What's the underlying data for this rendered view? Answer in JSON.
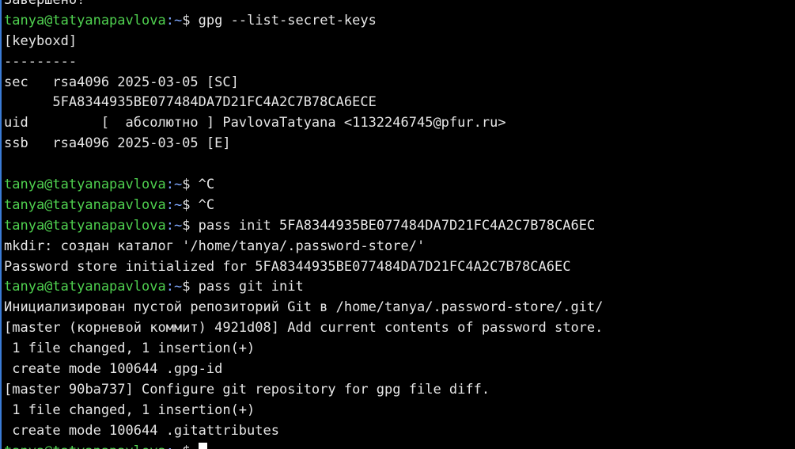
{
  "terminal": {
    "colors": {
      "background": "#000000",
      "text": "#e6e6e6",
      "prompt_user": "#4fd04f",
      "prompt_path": "#7fa8ff"
    },
    "prompt": {
      "user_host": "tanya@tatyanapavlova",
      "path": ":~",
      "symbol": "$ "
    },
    "lines": [
      {
        "type": "output",
        "text": "Завершено!"
      },
      {
        "type": "prompt",
        "cmd": "gpg --list-secret-keys"
      },
      {
        "type": "output",
        "text": "[keyboxd]"
      },
      {
        "type": "output",
        "text": "---------"
      },
      {
        "type": "output",
        "text": "sec   rsa4096 2025-03-05 [SC]"
      },
      {
        "type": "output",
        "text": "      5FA8344935BE077484DA7D21FC4A2C7B78CA6ECE"
      },
      {
        "type": "output",
        "text": "uid         [  абсолютно ] PavlovaTatyana <1132246745@pfur.ru>"
      },
      {
        "type": "output",
        "text": "ssb   rsa4096 2025-03-05 [E]"
      },
      {
        "type": "output",
        "text": ""
      },
      {
        "type": "prompt",
        "cmd": "^C"
      },
      {
        "type": "prompt",
        "cmd": "^C"
      },
      {
        "type": "prompt",
        "cmd": "pass init 5FA8344935BE077484DA7D21FC4A2C7B78CA6EC"
      },
      {
        "type": "output",
        "text": "mkdir: создан каталог '/home/tanya/.password-store/'"
      },
      {
        "type": "output",
        "text": "Password store initialized for 5FA8344935BE077484DA7D21FC4A2C7B78CA6EC"
      },
      {
        "type": "prompt",
        "cmd": "pass git init"
      },
      {
        "type": "output",
        "text": "Инициализирован пустой репозиторий Git в /home/tanya/.password-store/.git/"
      },
      {
        "type": "output",
        "text": "[master (корневой коммит) 4921d08] Add current contents of password store."
      },
      {
        "type": "output",
        "text": " 1 file changed, 1 insertion(+)"
      },
      {
        "type": "output",
        "text": " create mode 100644 .gpg-id"
      },
      {
        "type": "output",
        "text": "[master 90ba737] Configure git repository for gpg file diff."
      },
      {
        "type": "output",
        "text": " 1 file changed, 1 insertion(+)"
      },
      {
        "type": "output",
        "text": " create mode 100644 .gitattributes"
      },
      {
        "type": "prompt",
        "cmd": "",
        "cursor": true
      }
    ]
  }
}
